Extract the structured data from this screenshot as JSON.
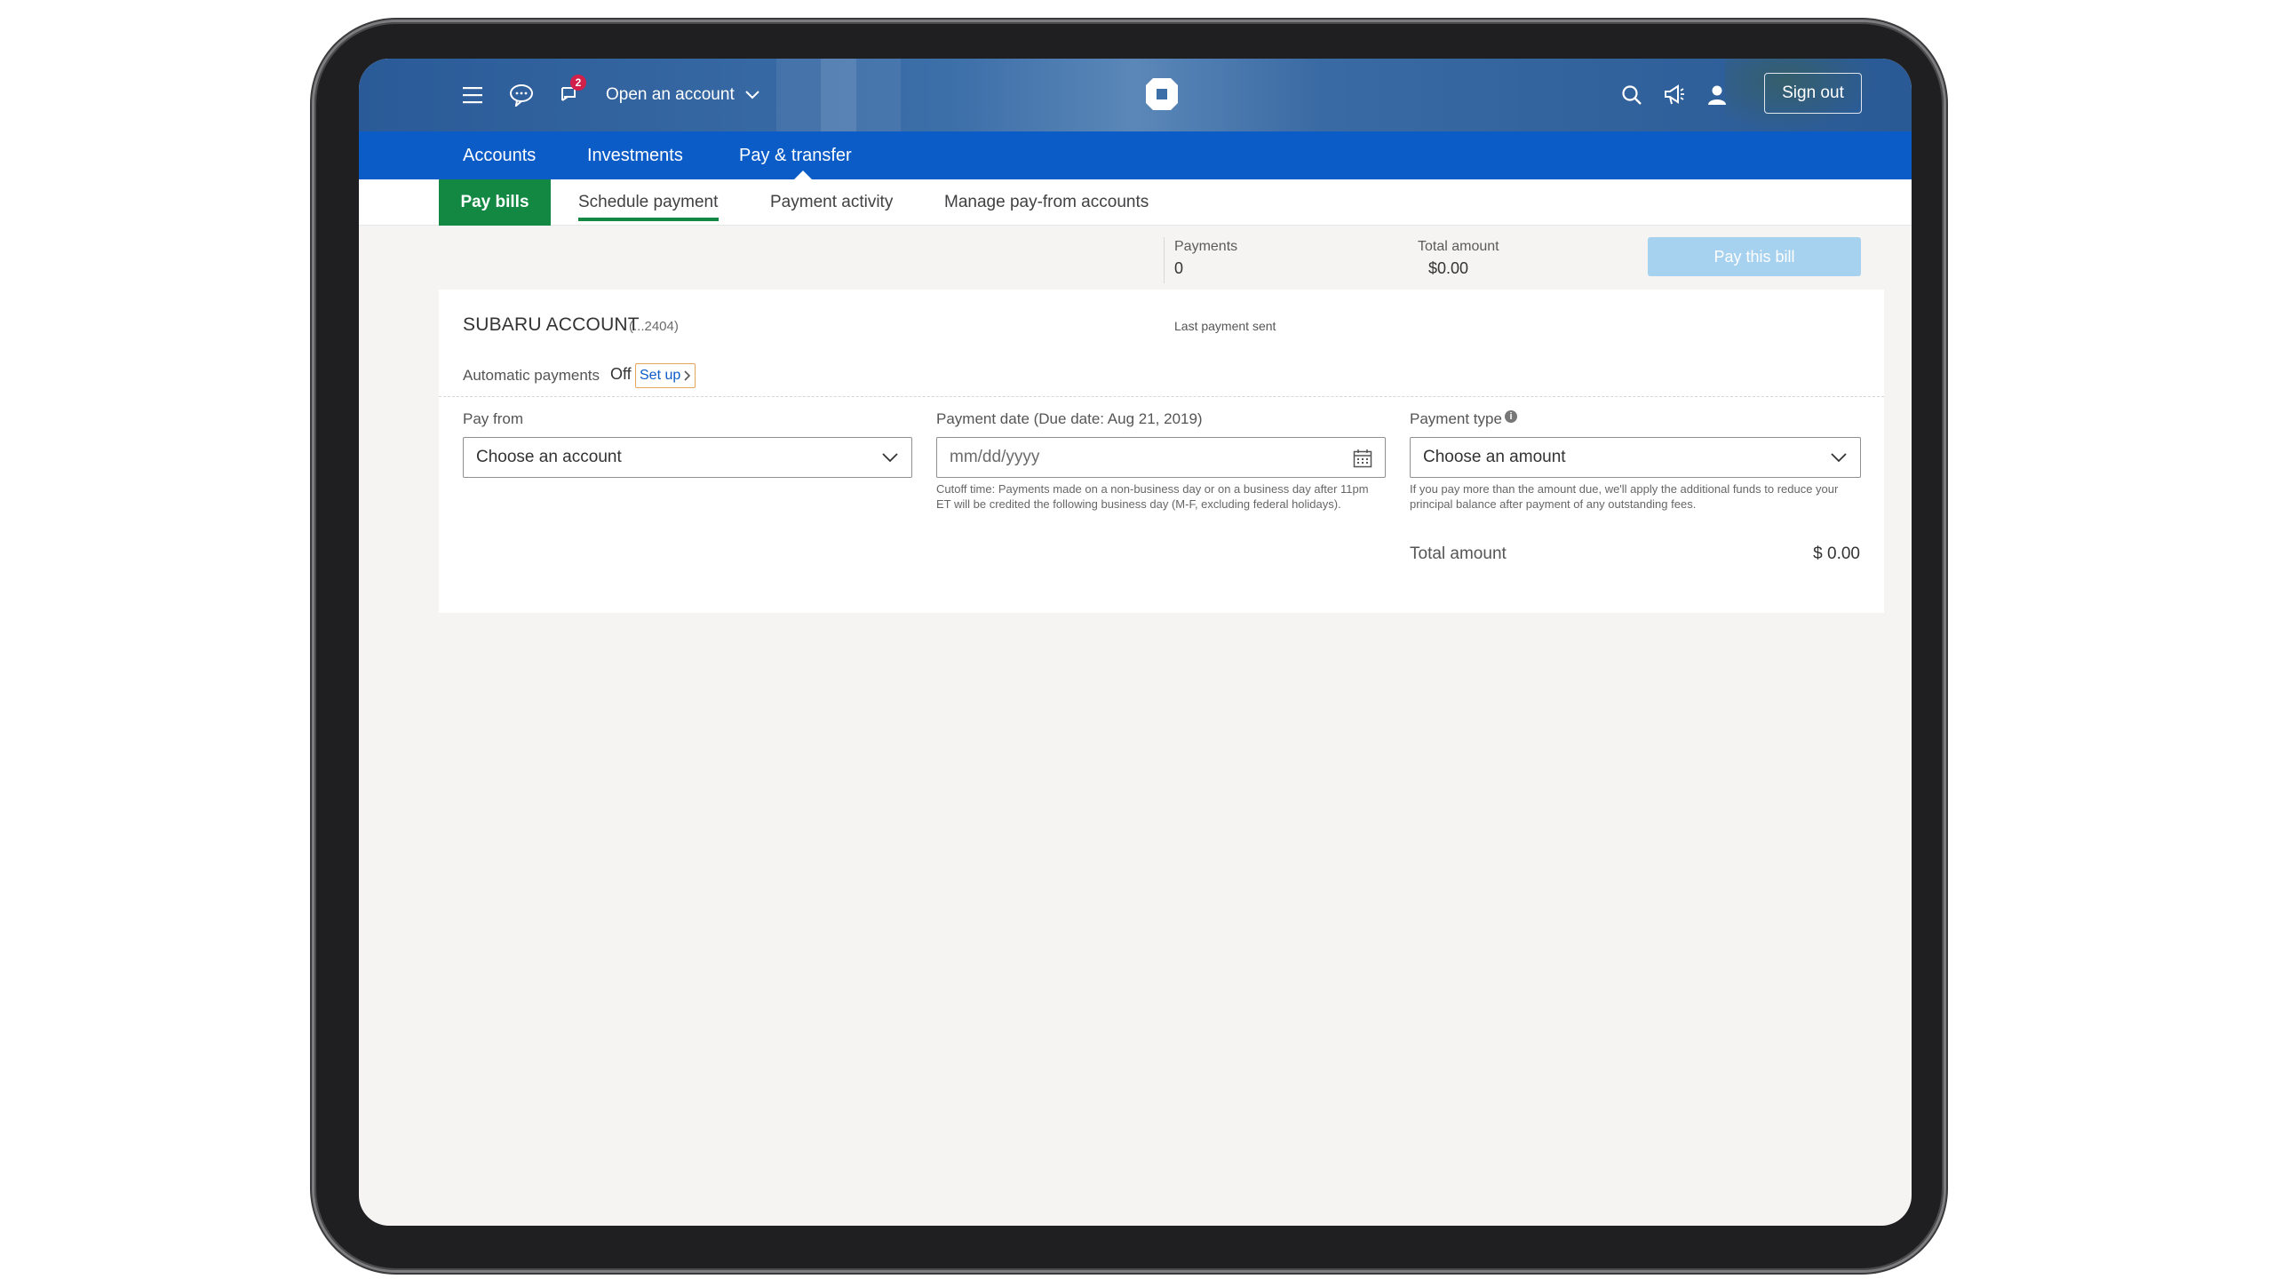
{
  "header": {
    "open_account_label": "Open an account",
    "notification_count": "2",
    "sign_out_label": "Sign out",
    "icons": [
      "menu-icon",
      "chat-icon",
      "alerts-icon",
      "chase-logo",
      "search-icon",
      "megaphone-icon",
      "profile-icon"
    ]
  },
  "main_nav": {
    "items": [
      "Accounts",
      "Investments",
      "Pay & transfer"
    ],
    "active": "Pay & transfer"
  },
  "sub_nav": {
    "items": [
      "Pay bills",
      "Schedule payment",
      "Payment activity",
      "Manage pay-from accounts"
    ],
    "active": "Pay bills",
    "selected_underline": "Schedule payment"
  },
  "summary": {
    "payments_label": "Payments",
    "payments_value": "0",
    "total_amount_label": "Total amount",
    "total_amount_value": "$0.00",
    "pay_button_label": "Pay this bill"
  },
  "account": {
    "name": "SUBARU ACCOUNT",
    "mask": "(...2404)",
    "last_payment_label": "Last payment sent",
    "autopay_label": "Automatic payments",
    "autopay_status": "Off",
    "setup_label": "Set up"
  },
  "form": {
    "pay_from_label": "Pay from",
    "pay_from_value": "Choose an account",
    "payment_date_label": "Payment date (Due date: Aug 21, 2019)",
    "payment_date_placeholder": "mm/dd/yyyy",
    "cutoff_help": "Cutoff time: Payments made on a non-business day or on a business day after 11pm ET will be credited the following business day (M-F, excluding federal holidays).",
    "payment_type_label": "Payment type",
    "payment_type_value": "Choose an amount",
    "payment_type_help": "If you pay more than the amount due, we'll apply the additional funds to reduce your principal balance after payment of any outstanding fees.",
    "total_label": "Total amount",
    "total_value": "$ 0.00"
  },
  "colors": {
    "header_blue": "#2a5b98",
    "nav_blue": "#0b5cc7",
    "active_green": "#128842",
    "pay_button_disabled": "#a6d1ef",
    "badge_red": "#d1214a"
  }
}
